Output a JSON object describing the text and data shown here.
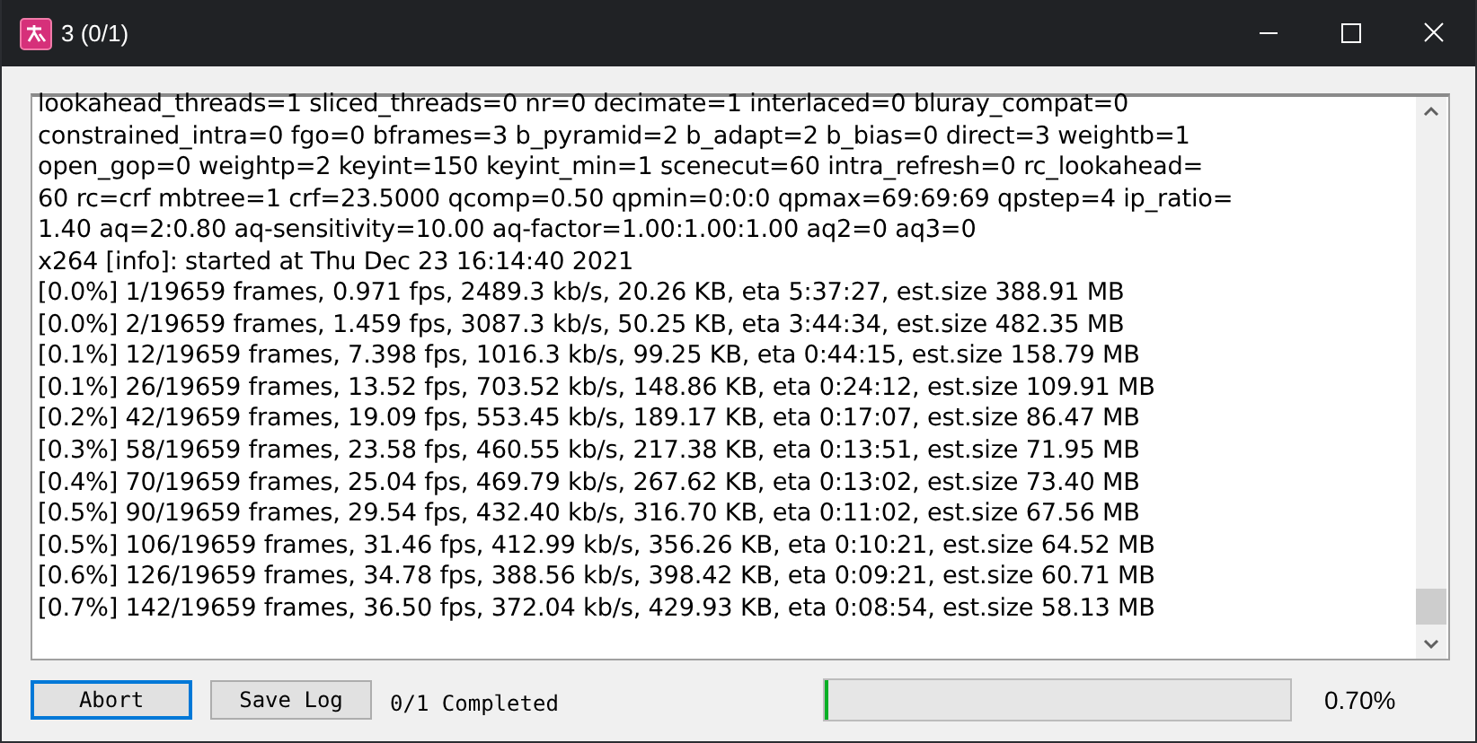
{
  "window": {
    "title": "3 (0/1)"
  },
  "log_lines": [
    "lookahead_threads=1 sliced_threads=0 nr=0 decimate=1 interlaced=0 bluray_compat=0",
    "constrained_intra=0 fgo=0 bframes=3 b_pyramid=2 b_adapt=2 b_bias=0 direct=3 weightb=1",
    "open_gop=0 weightp=2 keyint=150 keyint_min=1 scenecut=60 intra_refresh=0 rc_lookahead=",
    "60 rc=crf mbtree=1 crf=23.5000 qcomp=0.50 qpmin=0:0:0 qpmax=69:69:69 qpstep=4 ip_ratio=",
    "1.40 aq=2:0.80 aq-sensitivity=10.00 aq-factor=1.00:1.00:1.00 aq2=0 aq3=0",
    "x264 [info]: started at Thu Dec 23 16:14:40 2021",
    "[0.0%] 1/19659 frames, 0.971 fps, 2489.3 kb/s, 20.26 KB, eta 5:37:27, est.size 388.91 MB",
    "[0.0%] 2/19659 frames, 1.459 fps, 3087.3 kb/s, 50.25 KB, eta 3:44:34, est.size 482.35 MB",
    "[0.1%] 12/19659 frames, 7.398 fps, 1016.3 kb/s, 99.25 KB, eta 0:44:15, est.size 158.79 MB",
    "[0.1%] 26/19659 frames, 13.52 fps, 703.52 kb/s, 148.86 KB, eta 0:24:12, est.size 109.91 MB",
    "[0.2%] 42/19659 frames, 19.09 fps, 553.45 kb/s, 189.17 KB, eta 0:17:07, est.size 86.47 MB",
    "[0.3%] 58/19659 frames, 23.58 fps, 460.55 kb/s, 217.38 KB, eta 0:13:51, est.size 71.95 MB",
    "[0.4%] 70/19659 frames, 25.04 fps, 469.79 kb/s, 267.62 KB, eta 0:13:02, est.size 73.40 MB",
    "[0.5%] 90/19659 frames, 29.54 fps, 432.40 kb/s, 316.70 KB, eta 0:11:02, est.size 67.56 MB",
    "[0.5%] 106/19659 frames, 31.46 fps, 412.99 kb/s, 356.26 KB, eta 0:10:21, est.size 64.52 MB",
    "[0.6%] 126/19659 frames, 34.78 fps, 388.56 kb/s, 398.42 KB, eta 0:09:21, est.size 60.71 MB",
    "[0.7%] 142/19659 frames, 36.50 fps, 372.04 kb/s, 429.93 KB, eta 0:08:54, est.size 58.13 MB"
  ],
  "buttons": [
    {
      "label": "Abort",
      "selected": true
    },
    {
      "label": "Save Log",
      "selected": false
    }
  ],
  "status": "0/1 Completed",
  "progress": {
    "level": 0.007,
    "reading": "0.70%"
  }
}
